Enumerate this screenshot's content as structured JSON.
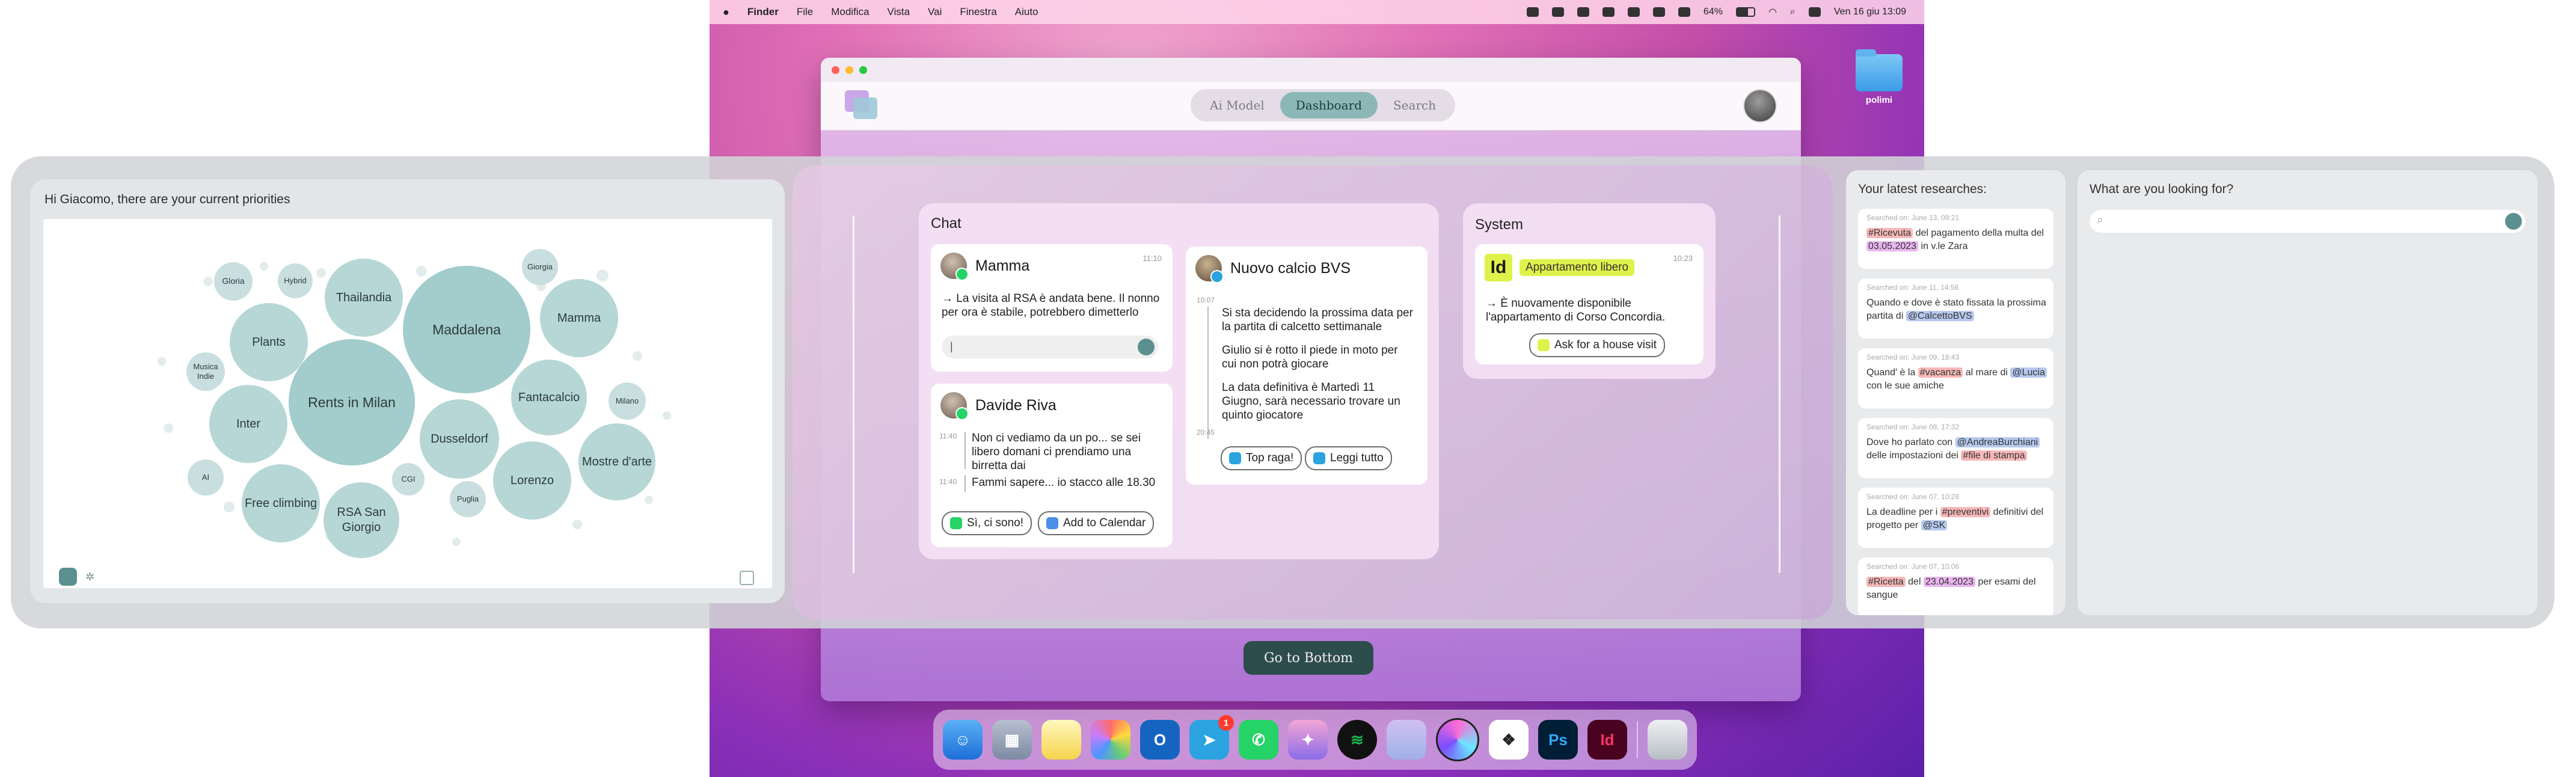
{
  "menubar": {
    "apple": "",
    "items": [
      "Finder",
      "File",
      "Modifica",
      "Vista",
      "Vai",
      "Finestra",
      "Aiuto"
    ],
    "battery": "64%",
    "datetime": "Ven 16 giu 13:09"
  },
  "desktop": {
    "folder_label": "polimi"
  },
  "app": {
    "tabs": [
      "Ai Model",
      "Dashboard",
      "Search"
    ],
    "active_tab": "Dashboard",
    "go_bottom": "Go to Bottom"
  },
  "priorities": {
    "title": "Hi Giacomo, there are your current priorities",
    "bubbles": [
      "Rents in Milan",
      "Maddalena",
      "Thailandia",
      "Plants",
      "Inter",
      "Free climbing",
      "RSA San Giorgio",
      "Dusseldorf",
      "Fantacalcio",
      "Lorenzo",
      "Mamma",
      "Mostre d'arte",
      "Musica Indie",
      "Gloria",
      "Hybrid",
      "Giorgia",
      "Milano",
      "AI",
      "CGI",
      "Puglia"
    ]
  },
  "chat": {
    "title": "Chat",
    "mamma": {
      "name": "Mamma",
      "time": "11:10",
      "message": "→ La visita al RSA è andata bene. Il nonno per ora è stabile, potrebbero dimetterlo",
      "input_value": "|"
    },
    "davide": {
      "name": "Davide Riva",
      "t1": "11:40",
      "m1": "Non ci vediamo da un po... se sei libero domani ci prendiamo una birretta dai",
      "t2": "11:40",
      "m2": "Fammi sapere... io stacco alle 18.30",
      "action1": "Sì, ci sono!",
      "action2": "Add to Calendar"
    },
    "calcio": {
      "name": "Nuovo calcio BVS",
      "t1": "10:07",
      "m1": "Si sta decidendo la prossima data per la partita di calcetto settimanale",
      "m2": "Giulio si è rotto il piede in moto per cui non potrà giocare",
      "m3": "La data definitiva è Martedì 11 Giugno, sarà necessario trovare un quinto giocatore",
      "t2": "20:45",
      "action1": "Top raga!",
      "action2": "Leggi tutto"
    }
  },
  "system": {
    "title": "System",
    "time": "10:23",
    "app_icon": "Id",
    "tag": "Appartamento libero",
    "message": "→ È nuovamente disponibile l'appartamento di Corso Concordia.",
    "action": "Ask for a house visit"
  },
  "researches": {
    "title": "Your latest researches:",
    "items": [
      {
        "date": "Searched on: June 13, 09:21",
        "pre": "",
        "a": "#Ricevuta",
        "mid": " del pagamento della multa del ",
        "b": "03.05.2023",
        "post": " in v.le Zara"
      },
      {
        "date": "Searched on: June 11, 14:56",
        "pre": "Quando e dove è stato fissata la prossima partita di ",
        "a": "",
        "mid": "",
        "b": "@CalcettoBVS",
        "post": ""
      },
      {
        "date": "Searched on: June 09, 18:43",
        "pre": "Quand' è la ",
        "a": "#vacanza",
        "mid": " al mare di ",
        "b": "@Lucia",
        "post": " con le sue amiche"
      },
      {
        "date": "Searched on: June 08, 17:32",
        "pre": "Dove ho parlato con ",
        "a": "@AndreaBurchiani",
        "mid": " delle impostazioni dei ",
        "b": "#file di stampa",
        "post": ""
      },
      {
        "date": "Searched on: June 07, 10:28",
        "pre": "La deadline per i ",
        "a": "#preventivi",
        "mid": " definitivi del progetto per ",
        "b": "@SK",
        "post": ""
      },
      {
        "date": "Searched on: June 07, 10:06",
        "pre": "",
        "a": "#Ricetta",
        "mid": " del ",
        "b": "23.04.2023",
        "post": " per esami del sangue"
      }
    ]
  },
  "search": {
    "title": "What are you looking for?",
    "placeholder": ""
  }
}
